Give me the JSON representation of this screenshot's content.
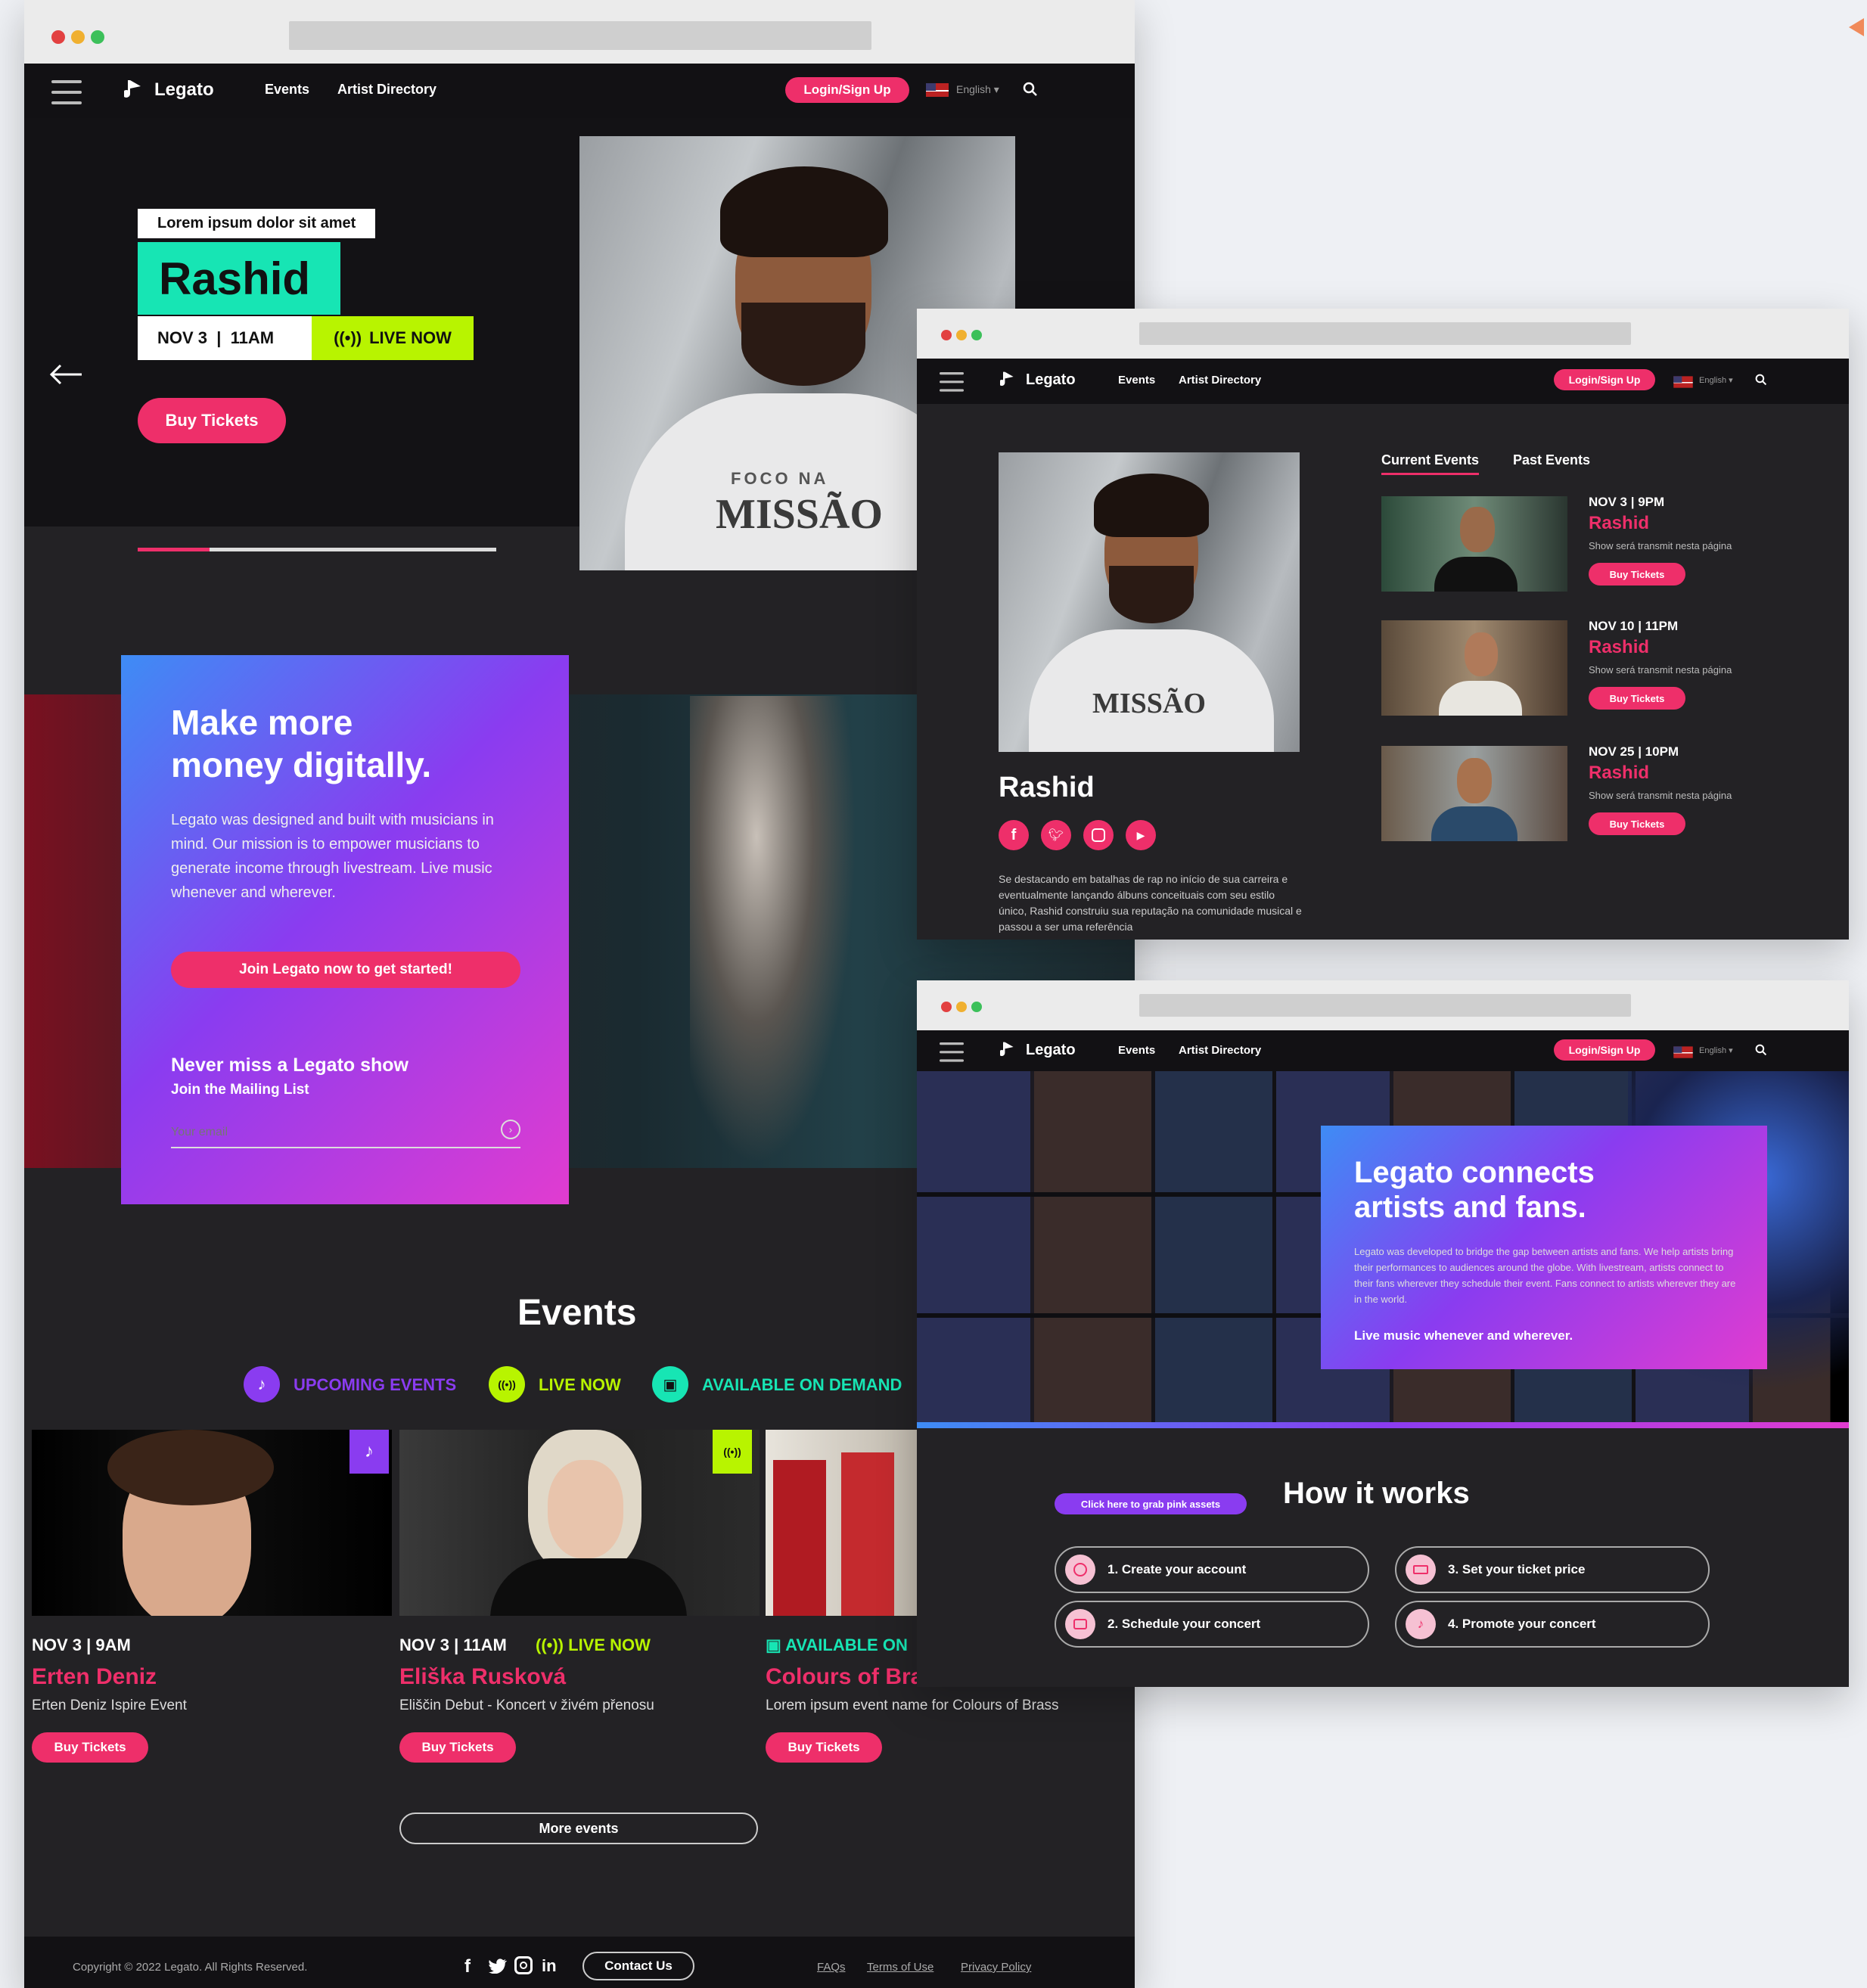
{
  "brand": "Legato",
  "nav": {
    "events": "Events",
    "artists": "Artist Directory",
    "login": "Login/Sign Up",
    "lang": "English ▾"
  },
  "hero": {
    "tag": "Lorem ipsum dolor sit amet",
    "artist": "Rashid",
    "date": "NOV 3  |  11AM",
    "live": "LIVE NOW",
    "buy": "Buy Tickets",
    "shirt_line1": "FOCO NA",
    "shirt_line2": "MISSÃO",
    "slider_progress": 0.2
  },
  "promo": {
    "heading1": "Make more",
    "heading2": "money digitally.",
    "body": "Legato was designed and built with musicians in mind. Our mission is to empower musicians to generate income through livestream. Live music whenever and wherever.",
    "cta": "Join Legato now to get started!",
    "mail_title": "Never miss a Legato show",
    "mail_sub": "Join the Mailing List",
    "email_placeholder": "Your email"
  },
  "events_section": {
    "title": "Events",
    "filters": [
      "UPCOMING EVENTS",
      "LIVE NOW",
      "AVAILABLE ON DEMAND"
    ],
    "cards": [
      {
        "date": "NOV 3 | 9AM",
        "name": "Erten Deniz",
        "desc": "Erten Deniz Ispire Event",
        "buy": "Buy Tickets"
      },
      {
        "date": "NOV 3 | 11AM",
        "live": "LIVE NOW",
        "name": "Eliška Rusková",
        "desc": "Eliščin Debut - Koncert v živém přenosu",
        "buy": "Buy Tickets"
      },
      {
        "badge": "AVAILABLE ON",
        "name": "Colours of Bra",
        "desc": "Lorem ipsum event name for Colours of Brass",
        "buy": "Buy Tickets"
      }
    ],
    "more": "More events"
  },
  "footer": {
    "copyright": "Copyright © 2022 Legato. All Rights Reserved.",
    "contact": "Contact Us",
    "links": [
      "FAQs",
      "Terms of Use",
      "Privacy Policy"
    ]
  },
  "artist_page": {
    "name": "Rashid",
    "bio": "Se destacando em batalhas de rap no início de sua carreira e eventualmente lançando álbuns conceituais com seu estilo único, Rashid construiu sua reputação na comunidade musical e passou a ser uma referência",
    "tabs": [
      "Current Events",
      "Past Events"
    ],
    "events": [
      {
        "date": "NOV 3 | 9PM",
        "name": "Rashid",
        "desc": "Show será transmit nesta página",
        "buy": "Buy Tickets"
      },
      {
        "date": "NOV 10 | 11PM",
        "name": "Rashid",
        "desc": "Show será transmit nesta página",
        "buy": "Buy Tickets"
      },
      {
        "date": "NOV 25 | 10PM",
        "name": "Rashid",
        "desc": "Show será transmit nesta página",
        "buy": "Buy Tickets"
      }
    ]
  },
  "about_page": {
    "heading1": "Legato connects",
    "heading2": "artists and fans.",
    "body": "Legato was developed to bridge the gap between artists and fans. We help artists bring their performances to audiences around the globe. With livestream, artists connect to their fans wherever they schedule their event. Fans connect to artists wherever they are in the world.",
    "tagline": "Live music whenever and wherever.",
    "how_title": "How it works",
    "assets_btn": "Click here to grab pink assets",
    "steps": [
      "1. Create your account",
      "2. Schedule your concert",
      "3. Set your ticket price",
      "4. Promote your concert"
    ]
  },
  "colors": {
    "accent": "#ee2f6a",
    "teal": "#17e5b4",
    "lime": "#b8f400",
    "purple": "#8a3cf0",
    "dark": "#232225"
  }
}
